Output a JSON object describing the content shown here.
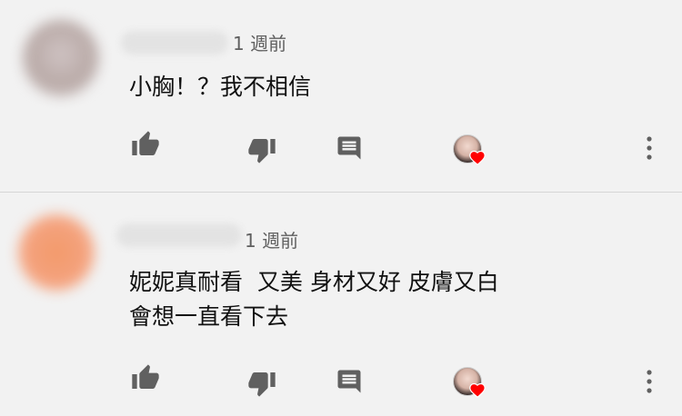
{
  "comments": [
    {
      "time": "1 週前",
      "lines": [
        "小胸！？我不相信"
      ]
    },
    {
      "time": "1 週前",
      "lines": [
        "妮妮真耐看  又美 身材又好 皮膚又白",
        "會想一直看下去"
      ]
    }
  ],
  "icons": {
    "like": "thumb-up-icon",
    "dislike": "thumb-down-icon",
    "reply": "reply-comment-icon",
    "creator_heart": "creator-heart-icon",
    "more": "more-vertical-icon"
  },
  "colors": {
    "background": "#f2f2f2",
    "icon": "#606060",
    "heart": "#ff0000",
    "divider": "#d6d6d6"
  }
}
